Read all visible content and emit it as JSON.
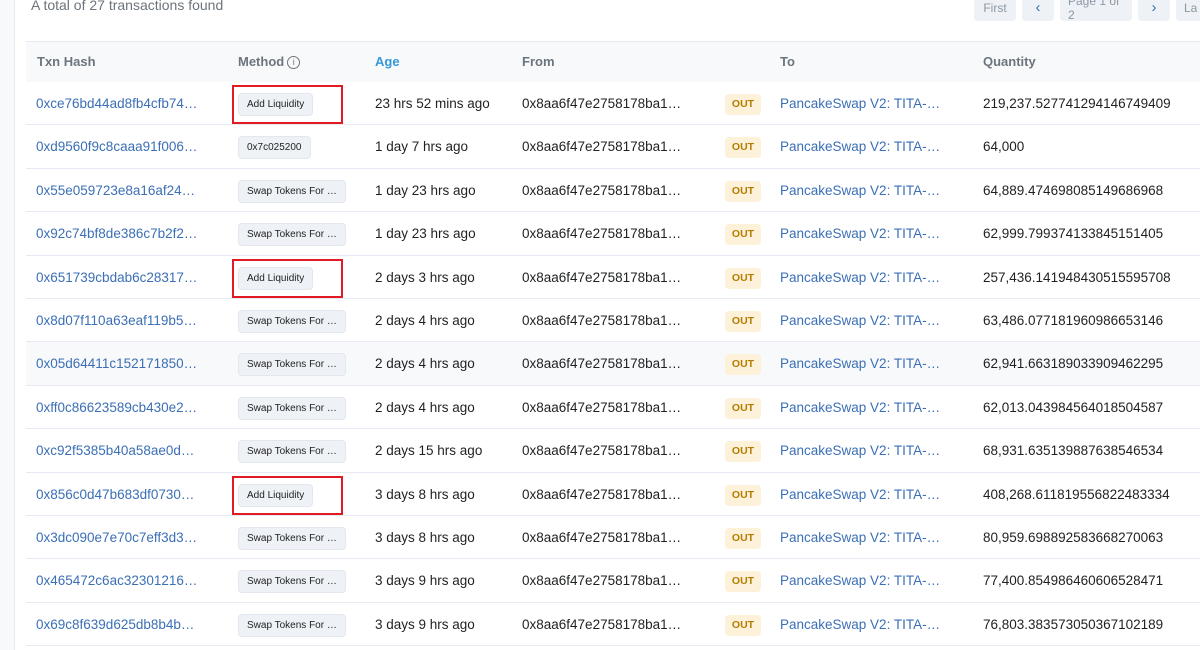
{
  "summary": "A total of 27 transactions found",
  "pagination": {
    "first": "First",
    "prev_icon": "chevron-left-icon",
    "prev": "‹",
    "page_info": "Page 1 of 2",
    "next_icon": "chevron-right-icon",
    "next": "›",
    "last": "La"
  },
  "columns": {
    "txn_hash": "Txn Hash",
    "method": "Method",
    "method_info": "i",
    "age": "Age",
    "from": "From",
    "to": "To",
    "quantity": "Quantity"
  },
  "rows": [
    {
      "hash": "0xce76bd44ad8fb4cfb74…",
      "method": "Add Liquidity",
      "age": "23 hrs 52 mins ago",
      "from": "0x8aa6f47e2758178ba1…",
      "dir": "OUT",
      "to": "PancakeSwap V2: TITA-…",
      "qty": "219,237.527741294146749409",
      "highlighted": true
    },
    {
      "hash": "0xd9560f9c8caaa91f006…",
      "method": "0x7c025200",
      "age": "1 day 7 hrs ago",
      "from": "0x8aa6f47e2758178ba1…",
      "dir": "OUT",
      "to": "PancakeSwap V2: TITA-…",
      "qty": "64,000",
      "highlighted": false
    },
    {
      "hash": "0x55e059723e8a16af24…",
      "method": "Swap Tokens For …",
      "age": "1 day 23 hrs ago",
      "from": "0x8aa6f47e2758178ba1…",
      "dir": "OUT",
      "to": "PancakeSwap V2: TITA-…",
      "qty": "64,889.474698085149686968",
      "highlighted": false
    },
    {
      "hash": "0x92c74bf8de386c7b2f2…",
      "method": "Swap Tokens For …",
      "age": "1 day 23 hrs ago",
      "from": "0x8aa6f47e2758178ba1…",
      "dir": "OUT",
      "to": "PancakeSwap V2: TITA-…",
      "qty": "62,999.799374133845151405",
      "highlighted": false
    },
    {
      "hash": "0x651739cbdab6c28317…",
      "method": "Add Liquidity",
      "age": "2 days 3 hrs ago",
      "from": "0x8aa6f47e2758178ba1…",
      "dir": "OUT",
      "to": "PancakeSwap V2: TITA-…",
      "qty": "257,436.141948430515595708",
      "highlighted": true
    },
    {
      "hash": "0x8d07f110a63eaf119b5…",
      "method": "Swap Tokens For …",
      "age": "2 days 4 hrs ago",
      "from": "0x8aa6f47e2758178ba1…",
      "dir": "OUT",
      "to": "PancakeSwap V2: TITA-…",
      "qty": "63,486.077181960986653146",
      "highlighted": false
    },
    {
      "hash": "0x05d64411c152171850…",
      "method": "Swap Tokens For …",
      "age": "2 days 4 hrs ago",
      "from": "0x8aa6f47e2758178ba1…",
      "dir": "OUT",
      "to": "PancakeSwap V2: TITA-…",
      "qty": "62,941.663189033909462295",
      "highlighted": false
    },
    {
      "hash": "0xff0c86623589cb430e2…",
      "method": "Swap Tokens For …",
      "age": "2 days 4 hrs ago",
      "from": "0x8aa6f47e2758178ba1…",
      "dir": "OUT",
      "to": "PancakeSwap V2: TITA-…",
      "qty": "62,013.043984564018504587",
      "highlighted": false
    },
    {
      "hash": "0xc92f5385b40a58ae0d…",
      "method": "Swap Tokens For …",
      "age": "2 days 15 hrs ago",
      "from": "0x8aa6f47e2758178ba1…",
      "dir": "OUT",
      "to": "PancakeSwap V2: TITA-…",
      "qty": "68,931.635139887638546534",
      "highlighted": false
    },
    {
      "hash": "0x856c0d47b683df0730…",
      "method": "Add Liquidity",
      "age": "3 days 8 hrs ago",
      "from": "0x8aa6f47e2758178ba1…",
      "dir": "OUT",
      "to": "PancakeSwap V2: TITA-…",
      "qty": "408,268.611819556822483334",
      "highlighted": true
    },
    {
      "hash": "0x3dc090e7e70c7eff3d3…",
      "method": "Swap Tokens For …",
      "age": "3 days 8 hrs ago",
      "from": "0x8aa6f47e2758178ba1…",
      "dir": "OUT",
      "to": "PancakeSwap V2: TITA-…",
      "qty": "80,959.698892583668270063",
      "highlighted": false
    },
    {
      "hash": "0x465472c6ac32301216…",
      "method": "Swap Tokens For …",
      "age": "3 days 9 hrs ago",
      "from": "0x8aa6f47e2758178ba1…",
      "dir": "OUT",
      "to": "PancakeSwap V2: TITA-…",
      "qty": "77,400.854986460606528471",
      "highlighted": false
    },
    {
      "hash": "0x69c8f639d625db8b4b…",
      "method": "Swap Tokens For …",
      "age": "3 days 9 hrs ago",
      "from": "0x8aa6f47e2758178ba1…",
      "dir": "OUT",
      "to": "PancakeSwap V2: TITA-…",
      "qty": "76,803.383573050367102189",
      "highlighted": false
    }
  ],
  "colors": {
    "link": "#3b6fb6",
    "age_header": "#3498db",
    "highlight_box": "#e01b24",
    "out_badge_bg": "#fdf1d9",
    "out_badge_text": "#b47d00"
  }
}
